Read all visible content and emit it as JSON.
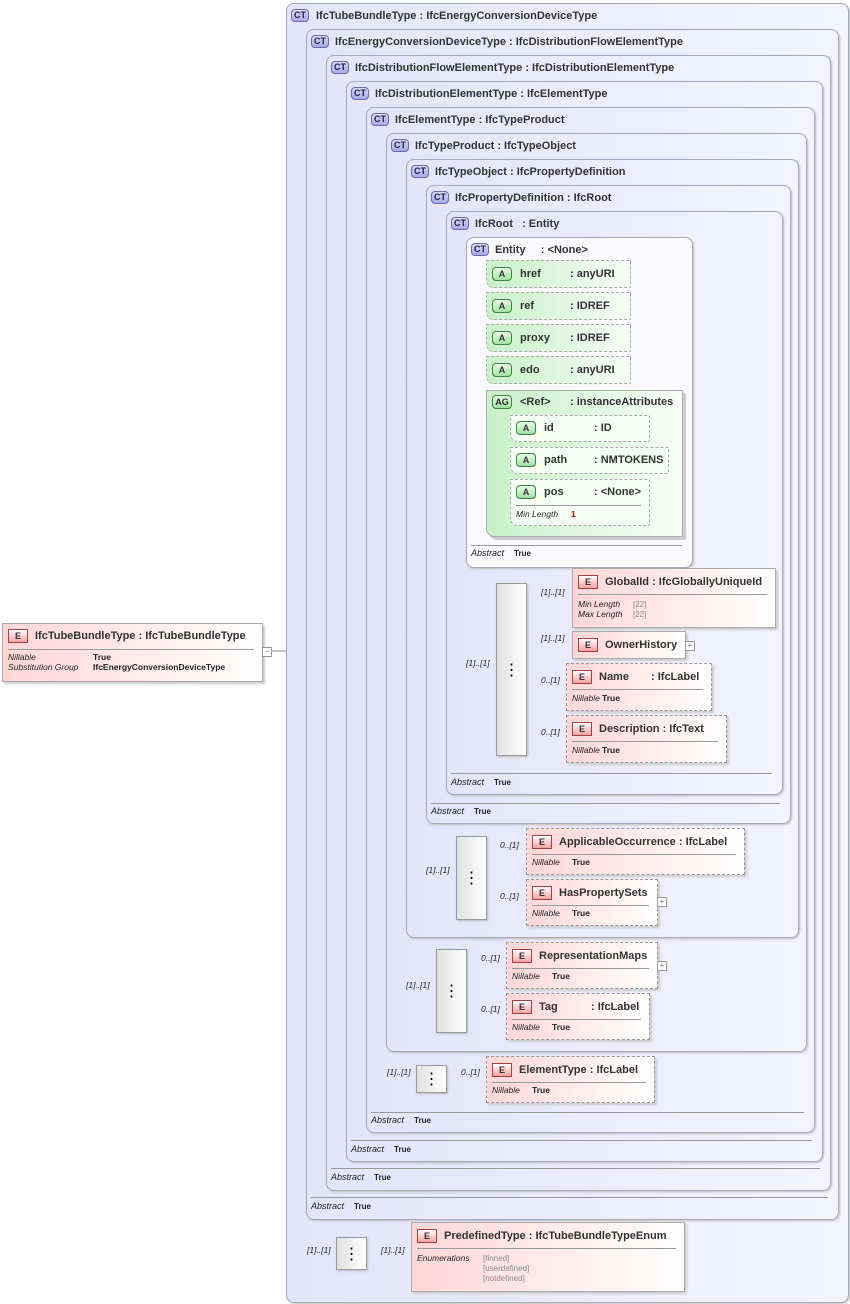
{
  "root_element": {
    "badge": "E",
    "name": "IfcTubeBundleType",
    "type": ": IfcTubeBundleType",
    "props": [
      {
        "k": "Nillable",
        "v": "True"
      },
      {
        "k": "Substitution Group",
        "v": "IfcEnergyConversionDeviceType"
      }
    ],
    "toggle": "−"
  },
  "complex_types": [
    {
      "badge": "CT",
      "name": "IfcTubeBundleType",
      "base": ": IfcEnergyConversionDeviceType"
    },
    {
      "badge": "CT",
      "name": "IfcEnergyConversionDeviceType",
      "base": ": IfcDistributionFlowElementType",
      "abstract": "Abstract",
      "abstract_val": "True"
    },
    {
      "badge": "CT",
      "name": "IfcDistributionFlowElementType",
      "base": ": IfcDistributionElementType",
      "abstract": "Abstract",
      "abstract_val": "True"
    },
    {
      "badge": "CT",
      "name": "IfcDistributionElementType",
      "base": ": IfcElementType",
      "abstract": "Abstract",
      "abstract_val": "True"
    },
    {
      "badge": "CT",
      "name": "IfcElementType",
      "base": ": IfcTypeProduct",
      "abstract": "Abstract",
      "abstract_val": "True"
    },
    {
      "badge": "CT",
      "name": "IfcTypeProduct",
      "base": ": IfcTypeObject"
    },
    {
      "badge": "CT",
      "name": "IfcTypeObject",
      "base": ": IfcPropertyDefinition"
    },
    {
      "badge": "CT",
      "name": "IfcPropertyDefinition",
      "base": ": IfcRoot",
      "abstract": "Abstract",
      "abstract_val": "True"
    },
    {
      "badge": "CT",
      "name": "IfcRoot",
      "base": ": Entity",
      "abstract": "Abstract",
      "abstract_val": "True"
    },
    {
      "badge": "CT",
      "name": "Entity",
      "base": ": <None>",
      "abstract": "Abstract",
      "abstract_val": "True"
    }
  ],
  "attributes": [
    {
      "badge": "A",
      "name": "href",
      "type": ": anyURI"
    },
    {
      "badge": "A",
      "name": "ref",
      "type": ": IDREF"
    },
    {
      "badge": "A",
      "name": "proxy",
      "type": ": IDREF"
    },
    {
      "badge": "A",
      "name": "edo",
      "type": ": anyURI"
    }
  ],
  "attribute_group": {
    "badge": "AG",
    "name": "<Ref>",
    "type": ": instanceAttributes",
    "items": [
      {
        "badge": "A",
        "name": "id",
        "type": ": ID"
      },
      {
        "badge": "A",
        "name": "path",
        "type": ": NMTOKENS"
      },
      {
        "badge": "A",
        "name": "pos",
        "type": ": <None>",
        "facet": "Min Length",
        "facet_val": "1"
      }
    ]
  },
  "elements": {
    "global_id": {
      "badge": "E",
      "name": "GlobalId",
      "type": ": IfcGloballyUniqueId",
      "props": [
        {
          "k": "Min Length",
          "v": "[22]"
        },
        {
          "k": "Max Length",
          "v": "[22]"
        }
      ],
      "card": "[1]..[1]"
    },
    "owner_history": {
      "badge": "E",
      "name": "OwnerHistory",
      "card": "[1]..[1]",
      "toggle": "+"
    },
    "name": {
      "badge": "E",
      "name": "Name",
      "type": ": IfcLabel",
      "props": [
        {
          "k": "Nillable",
          "v": "True"
        }
      ],
      "card": "0..[1]"
    },
    "description": {
      "badge": "E",
      "name": "Description",
      "type": ": IfcText",
      "props": [
        {
          "k": "Nillable",
          "v": "True"
        }
      ],
      "card": "0..[1]"
    },
    "applicable_occurrence": {
      "badge": "E",
      "name": "ApplicableOccurrence",
      "type": ": IfcLabel",
      "props": [
        {
          "k": "Nillable",
          "v": "True"
        }
      ],
      "card": "0..[1]"
    },
    "has_property_sets": {
      "badge": "E",
      "name": "HasPropertySets",
      "props": [
        {
          "k": "Nillable",
          "v": "True"
        }
      ],
      "card": "0..[1]",
      "toggle": "+"
    },
    "representation_maps": {
      "badge": "E",
      "name": "RepresentationMaps",
      "props": [
        {
          "k": "Nillable",
          "v": "True"
        }
      ],
      "card": "0..[1]",
      "toggle": "+"
    },
    "tag": {
      "badge": "E",
      "name": "Tag",
      "type": ": IfcLabel",
      "props": [
        {
          "k": "Nillable",
          "v": "True"
        }
      ],
      "card": "0..[1]"
    },
    "element_type": {
      "badge": "E",
      "name": "ElementType",
      "type": ": IfcLabel",
      "props": [
        {
          "k": "Nillable",
          "v": "True"
        }
      ],
      "card": "0..[1]"
    },
    "predefined_type": {
      "badge": "E",
      "name": "PredefinedType",
      "type": ": IfcTubeBundleTypeEnum",
      "enum_label": "Enumerations",
      "enums": [
        "[finned]",
        "[userdefined]",
        "[notdefined]"
      ],
      "card": "[1]..[1]"
    }
  },
  "sequence_cards": {
    "root": "[1]..[1]",
    "type_object": "[1]..[1]",
    "type_product": "[1]..[1]",
    "element_type": "[1]..[1]",
    "outer": "[1]..[1]"
  }
}
